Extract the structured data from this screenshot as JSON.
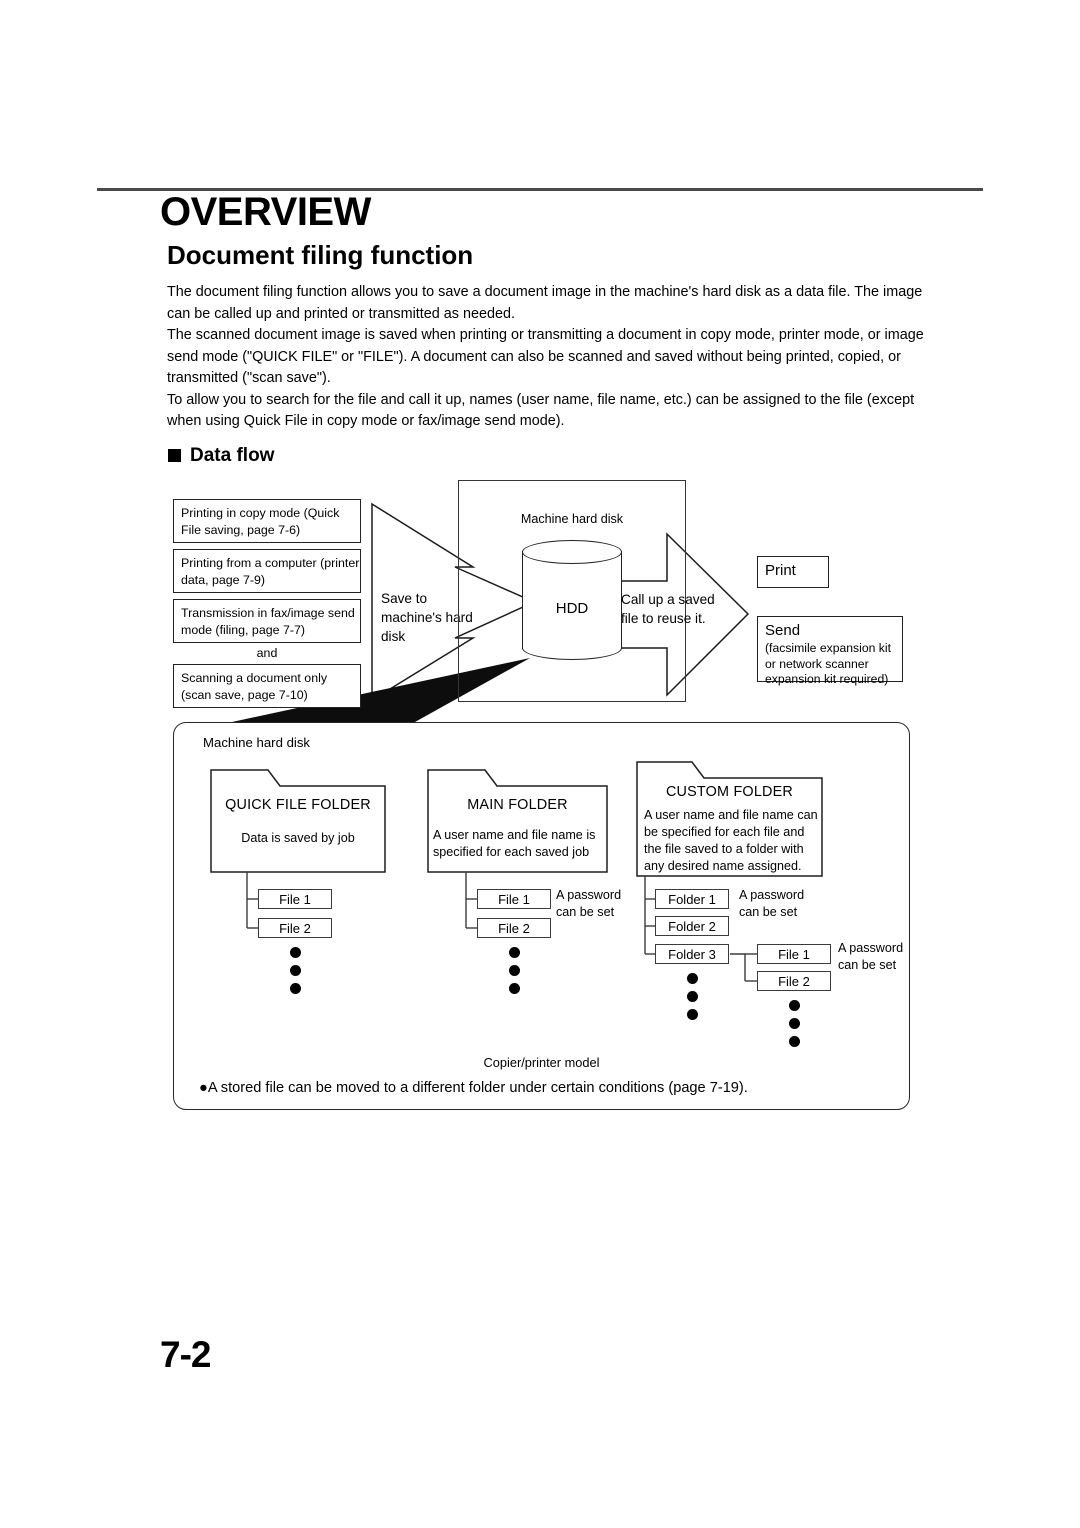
{
  "header": {
    "title": "OVERVIEW",
    "subtitle": "Document filing function"
  },
  "intro": {
    "p1": "The document filing function allows you to save a document image in the machine's hard disk as a data file. The image can be called up and printed or transmitted as needed.",
    "p2": "The scanned document image is saved when printing or transmitting a document in copy mode, printer mode, or image send mode (\"QUICK FILE\" or \"FILE\"). A document can also be scanned and saved without being printed, copied, or transmitted (\"scan save\").",
    "p3": "To allow you to search for the file and call it up, names (user name, file name, etc.) can be assigned to the file (except when using Quick File in copy mode or fax/image send mode)."
  },
  "section": {
    "data_flow_title": "Data flow"
  },
  "flow": {
    "sources": [
      "Printing in copy mode (Quick File saving, page 7-6)",
      "Printing from a computer (printer data, page 7-9)",
      "Transmission in fax/image send mode (filing, page 7-7)",
      "Scanning a document only (scan save, page 7-10)"
    ],
    "and_label": "and",
    "save_arrow_label": "Save to machine's hard disk",
    "hard_disk_caption": "Machine hard disk",
    "hdd_label": "HDD",
    "callup_arrow_label": "Call up a saved file to reuse it.",
    "print_label": "Print",
    "send_label": "Send",
    "send_note": "(facsimile expansion kit or network scanner expansion kit required)"
  },
  "storage": {
    "panel_label": "Machine hard disk",
    "folders": [
      {
        "title": "QUICK FILE FOLDER",
        "desc": "Data is saved by job",
        "children": [
          "File 1",
          "File 2"
        ]
      },
      {
        "title": "MAIN FOLDER",
        "desc": "A user name and file name is specified for each saved job",
        "children": [
          "File 1",
          "File 2"
        ],
        "note": "A password can be set"
      },
      {
        "title": "CUSTOM FOLDER",
        "desc": "A user name and file name can be specified for each file and the file saved to a folder with any desired name assigned.",
        "children": [
          "Folder 1",
          "Folder 2",
          "Folder 3"
        ],
        "note": "A password can be set",
        "grandchildren": [
          "File 1",
          "File 2"
        ],
        "grandchild_note": "A password can be set"
      }
    ],
    "model_label": "Copier/printer model",
    "moved_note": "●A stored file can be moved to a different folder under certain conditions (page 7-19)."
  },
  "footer": {
    "page_number": "7-2"
  }
}
